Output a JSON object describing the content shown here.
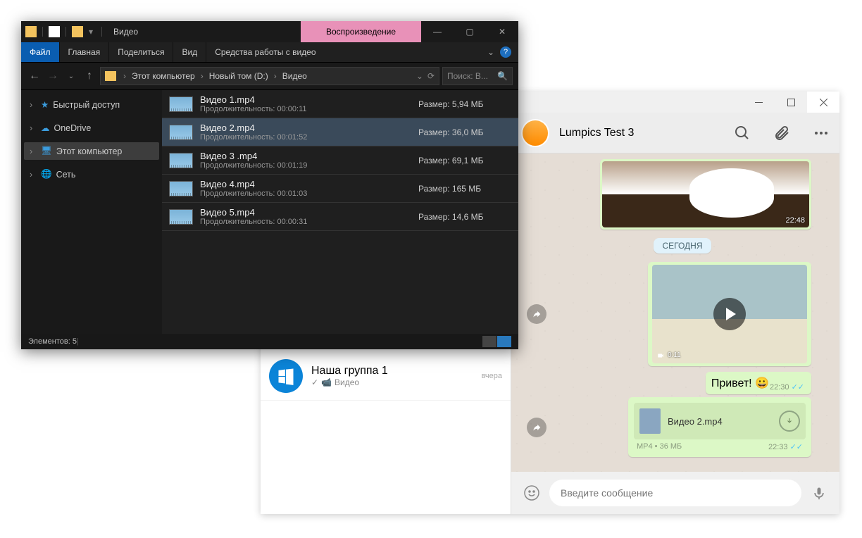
{
  "explorer": {
    "title": "Видео",
    "play_tab": "Воспроизведение",
    "ribbon": {
      "file": "Файл",
      "home": "Главная",
      "share": "Поделиться",
      "view": "Вид",
      "video_tools": "Средства работы с видео"
    },
    "breadcrumb": {
      "pc": "Этот компьютер",
      "drive": "Новый том (D:)",
      "folder": "Видео"
    },
    "search_placeholder": "Поиск: В...",
    "tree": {
      "quick": "Быстрый доступ",
      "onedrive": "OneDrive",
      "thispc": "Этот компьютер",
      "network": "Сеть"
    },
    "files": [
      {
        "name": "Видео 1.mp4",
        "dur_label": "Продолжительность:",
        "dur": "00:00:11",
        "size_label": "Размер:",
        "size": "5,94 МБ"
      },
      {
        "name": "Видео 2.mp4",
        "dur_label": "Продолжительность:",
        "dur": "00:01:52",
        "size_label": "Размер:",
        "size": "36,0 МБ"
      },
      {
        "name": "Видео 3 .mp4",
        "dur_label": "Продолжительность:",
        "dur": "00:01:19",
        "size_label": "Размер:",
        "size": "69,1 МБ"
      },
      {
        "name": "Видео 4.mp4",
        "dur_label": "Продолжительность:",
        "dur": "00:01:03",
        "size_label": "Размер:",
        "size": "165 МБ"
      },
      {
        "name": "Видео 5.mp4",
        "dur_label": "Продолжительность:",
        "dur": "00:00:31",
        "size_label": "Размер:",
        "size": "14,6 МБ"
      }
    ],
    "status": "Элементов: 5"
  },
  "whatsapp": {
    "chatlist": {
      "group_title": "Наша группа 1",
      "group_sub": "Видео",
      "group_time": "вчера"
    },
    "header": {
      "contact": "Lumpics Test 3"
    },
    "date_pill": "СЕГОДНЯ",
    "coffee_time": "22:48",
    "video": {
      "len": "0:11",
      "time": ""
    },
    "greet": {
      "text": "Привет! 😀",
      "time": "22:30"
    },
    "filemsg": {
      "name": "Видео 2.mp4",
      "meta": "MP4 • 36 МБ",
      "time": "22:33"
    },
    "compose_placeholder": "Введите сообщение"
  }
}
